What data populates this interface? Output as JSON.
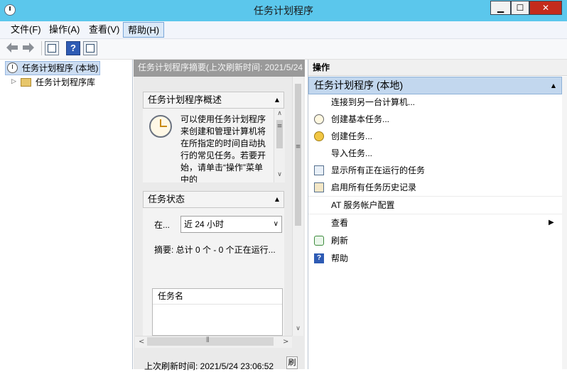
{
  "window": {
    "title": "任务计划程序",
    "min_symbol": "▁",
    "max_symbol": "☐",
    "close_symbol": "✕"
  },
  "menu": {
    "file": "文件(F)",
    "action": "操作(A)",
    "view": "查看(V)",
    "help": "帮助(H)"
  },
  "toolbar": {
    "help_symbol": "?"
  },
  "tree": {
    "root": "任务计划程序 (本地)",
    "library": "任务计划程序库"
  },
  "middle": {
    "header": "任务计划程序摘要(上次刷新时间: 2021/5/24",
    "overview_title": "任务计划程序概述",
    "overview_text": "可以使用任务计划程序来创建和管理计算机将在所指定的时间自动执行的常见任务。若要开始，请单击“操作”菜单中的",
    "status_title": "任务状态",
    "status_label": "在...",
    "status_range": "近 24 小时",
    "status_summary": "摘要: 总计 0 个 - 0 个正在运行...",
    "task_column": "任务名",
    "last_refresh": "上次刷新时间: 2021/5/24 23:06:52",
    "refresh_button": "刷"
  },
  "actions": {
    "header": "操作",
    "group": "任务计划程序 (本地)",
    "items": [
      {
        "label": "连接到另一台计算机...",
        "icon": "none"
      },
      {
        "label": "创建基本任务...",
        "icon": "basic-task-icon"
      },
      {
        "label": "创建任务...",
        "icon": "create-task-icon"
      },
      {
        "label": "导入任务...",
        "icon": "none"
      },
      {
        "label": "显示所有正在运行的任务",
        "icon": "running-tasks-icon"
      },
      {
        "label": "启用所有任务历史记录",
        "icon": "history-icon"
      },
      {
        "label": "AT 服务帐户配置",
        "icon": "none"
      },
      {
        "label": "查看",
        "icon": "none",
        "submenu": "▶"
      },
      {
        "label": "刷新",
        "icon": "refresh-icon"
      },
      {
        "label": "帮助",
        "icon": "help-icon"
      }
    ]
  }
}
